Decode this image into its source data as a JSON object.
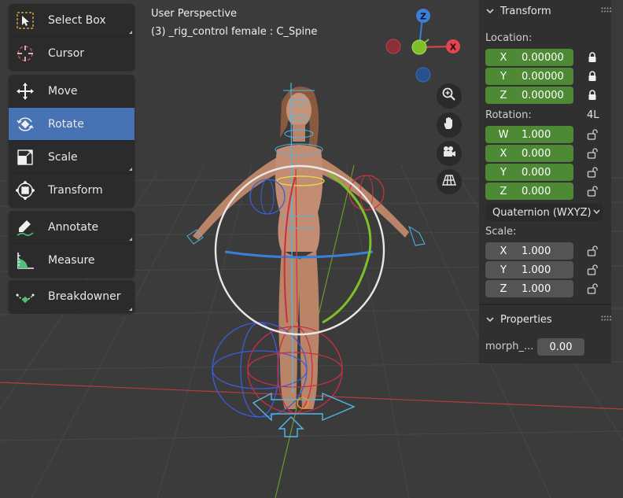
{
  "viewport": {
    "header": "User Perspective",
    "subheader": "(3) _rig_control female : C_Spine",
    "gizmo": {
      "z_label": "Z",
      "x_label": "X"
    },
    "nav_icons": [
      "zoom-icon",
      "hand-pan-icon",
      "camera-icon",
      "grid-perspective-icon"
    ]
  },
  "toolbar": {
    "select_box": "Select Box",
    "cursor": "Cursor",
    "move": "Move",
    "rotate": "Rotate",
    "scale": "Scale",
    "transform": "Transform",
    "annotate": "Annotate",
    "measure": "Measure",
    "breakdowner": "Breakdowner",
    "active_tool": "Rotate"
  },
  "npanel": {
    "transform_title": "Transform",
    "location_label": "Location:",
    "location": [
      {
        "axis": "X",
        "value": "0.00000"
      },
      {
        "axis": "Y",
        "value": "0.00000"
      },
      {
        "axis": "Z",
        "value": "0.00000"
      }
    ],
    "rotation_label": "Rotation:",
    "rotation_mode_short": "4L",
    "rotation": [
      {
        "axis": "W",
        "value": "1.000"
      },
      {
        "axis": "X",
        "value": "0.000"
      },
      {
        "axis": "Y",
        "value": "0.000"
      },
      {
        "axis": "Z",
        "value": "0.000"
      }
    ],
    "rotation_mode": "Quaternion (WXYZ)",
    "scale_label": "Scale:",
    "scale": [
      {
        "axis": "X",
        "value": "1.000"
      },
      {
        "axis": "Y",
        "value": "1.000"
      },
      {
        "axis": "Z",
        "value": "1.000"
      }
    ],
    "properties_title": "Properties",
    "morph_label": "morph_...",
    "morph_value": "0.00"
  },
  "colors": {
    "active_tool": "#4772b3",
    "location_field": "#4e8a35",
    "axis_x": "#e04550",
    "axis_y": "#7fbf2a",
    "axis_z": "#3a80d8"
  }
}
